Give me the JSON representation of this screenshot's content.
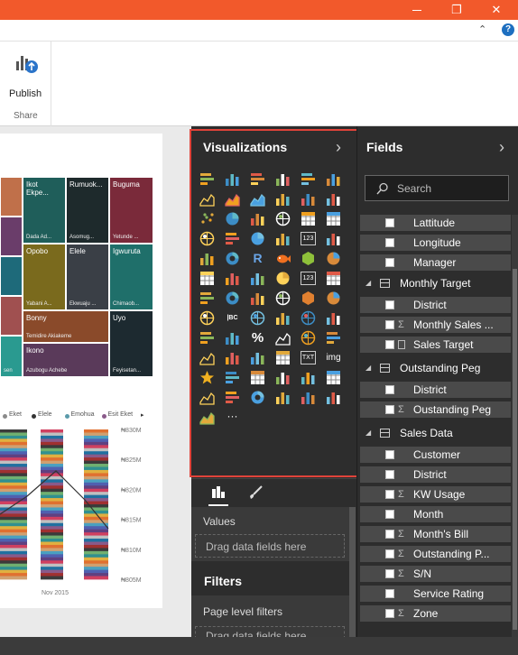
{
  "window": {
    "controls": {
      "restore": "❐",
      "close": "✕"
    },
    "help": "?",
    "collapse": "⌃"
  },
  "ribbon": {
    "publish_label": "Publish",
    "group_label": "Share"
  },
  "report": {
    "treemap": [
      {
        "name": "Ikot Ekpe...",
        "sub": "Dada Ad...",
        "color": "#1f5e5a"
      },
      {
        "name": "Rumuok...",
        "sub": "Asomug...",
        "color": "#1e2a2c"
      },
      {
        "name": "Buguma",
        "sub": "Yetunde ...",
        "color": "#7a2a3a"
      },
      {
        "name": "Opobo",
        "sub": "Yabani A...",
        "color": "#7a6a1d"
      },
      {
        "name": "Elele",
        "sub": "Ekwuaju ...",
        "color": "#3a3f46"
      },
      {
        "name": "Igwuruta",
        "sub": "Chimaob...",
        "color": "#1f6f6a"
      },
      {
        "name": "Bonny",
        "sub": "Temidire Akiakeme",
        "color": "#8a4a2a"
      },
      {
        "name": "Uyo",
        "sub": "Feyisetan...",
        "color": "#1d2a30"
      },
      {
        "name": "Ikono",
        "sub": "Azubogu Achebe",
        "color": "#5a3a5a"
      }
    ],
    "left_edge_cells": [
      {
        "color": "#c0704a"
      },
      {
        "color": "#6a3d6a"
      },
      {
        "color": "#1e6a7a"
      },
      {
        "color": "#a05050"
      },
      {
        "color": "#2a9a90",
        "sub": "sen"
      }
    ],
    "legend": [
      "Eket",
      "Elele",
      "Emohua",
      "Esit Eket"
    ],
    "legend_colors": [
      "#8a8a8a",
      "#333333",
      "#5a9aaa",
      "#8a5a8a"
    ],
    "legend_more": "▸",
    "chart_data": {
      "type": "bar",
      "categories": [
        "Nov 2015"
      ],
      "x_tick": "Nov 2015",
      "y_ticks": [
        "₦830M",
        "₦825M",
        "₦820M",
        "₦815M",
        "₦810M",
        "₦805M"
      ],
      "ylim": [
        805,
        830
      ]
    }
  },
  "visualizations": {
    "title": "Visualizations",
    "chevron": "›",
    "tabs": [
      {
        "name": "fields-tab"
      },
      {
        "name": "format-tab"
      }
    ],
    "values_label": "Values",
    "drop_hint": "Drag data fields here",
    "filters_title": "Filters",
    "page_filters": "Page level filters",
    "drop_hint2": "Drag data fields here",
    "icon_labels": {
      "r": "R",
      "pct": "%",
      "num": "123",
      "txt": "TXT",
      "img": "img",
      "more": "···",
      "barcode": "|BC"
    }
  },
  "fields": {
    "title": "Fields",
    "chevron": "›",
    "search_placeholder": "Search",
    "loose_fields": [
      {
        "name": "Lattitude",
        "sigma": false
      },
      {
        "name": "Longitude",
        "sigma": false
      },
      {
        "name": "Manager",
        "sigma": false
      }
    ],
    "tables": [
      {
        "name": "Monthly Target",
        "fields": [
          {
            "name": "District",
            "sigma": false
          },
          {
            "name": "Monthly Sales ...",
            "sigma": true
          },
          {
            "name": "Sales Target",
            "sigma": false,
            "calc": true
          }
        ]
      },
      {
        "name": "Outstanding Peg",
        "fields": [
          {
            "name": "District",
            "sigma": false
          },
          {
            "name": "Oustanding Peg",
            "sigma": true
          }
        ]
      },
      {
        "name": "Sales Data",
        "fields": [
          {
            "name": "Customer",
            "sigma": false
          },
          {
            "name": "District",
            "sigma": false
          },
          {
            "name": "KW Usage",
            "sigma": true
          },
          {
            "name": "Month",
            "sigma": false
          },
          {
            "name": "Month's Bill",
            "sigma": true
          },
          {
            "name": "Outstanding P...",
            "sigma": true
          },
          {
            "name": "S/N",
            "sigma": true
          },
          {
            "name": "Service Rating",
            "sigma": false
          },
          {
            "name": "Zone",
            "sigma": true
          }
        ]
      }
    ],
    "sigma_symbol": "Σ"
  }
}
